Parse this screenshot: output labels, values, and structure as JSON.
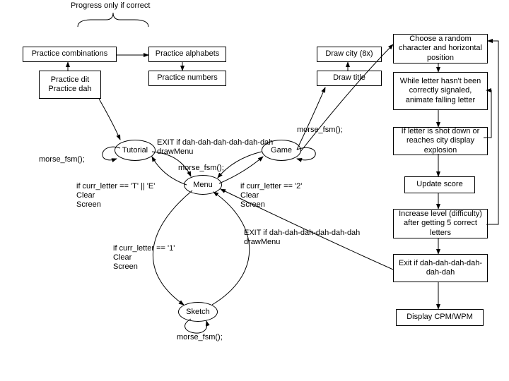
{
  "top_caption": "Progress only if correct",
  "practice": {
    "combinations": "Practice combinations",
    "alphabets": "Practice alphabets",
    "numbers": "Practice numbers",
    "dit_dah": "Practice dit\nPractice dah"
  },
  "states": {
    "tutorial": "Tutorial",
    "menu": "Menu",
    "game": "Game",
    "sketch": "Sketch"
  },
  "labels": {
    "morse_fsm": "morse_fsm();",
    "exit_drawmenu": "EXIT if dah-dah-dah-dah-dah-dah\ndrawMenu",
    "te_clear": "if curr_letter == 'T' || 'E'\nClear\nScreen",
    "two_clear": "if curr_letter == '2'\nClear\nScreen",
    "one_clear": "if curr_letter == '1'\nClear\nScreen"
  },
  "game_setup": {
    "draw_city": "Draw city (8x)",
    "draw_title": "Draw title"
  },
  "flow": {
    "choose": "Choose a random character and horizontal position",
    "animate": "While letter hasn't been correctly signaled, animate falling letter",
    "explosion": "If letter is shot down or reaches city display explosion",
    "score": "Update score",
    "level": "Increase level (difficulty) after getting 5 correct letters",
    "exit": "Exit if dah-dah-dah-dah-dah-dah",
    "cpm": "Display CPM/WPM"
  }
}
